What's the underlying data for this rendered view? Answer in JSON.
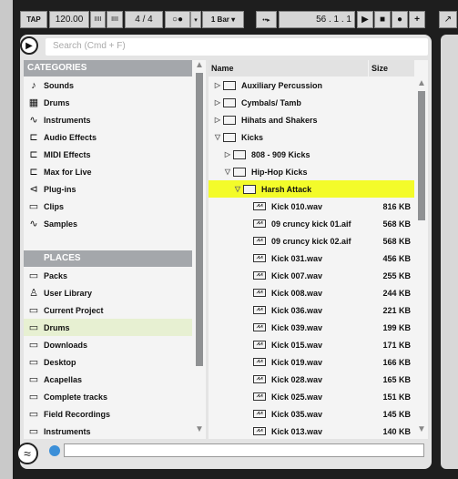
{
  "toolbar": {
    "tap": "TAP",
    "tempo": "120.00",
    "nudge_down": "IIII",
    "nudge_up": "IIII",
    "signature": "4 / 4",
    "metronome": "○●",
    "metronome_arrow": "▾",
    "quantize": "1 Bar ▾",
    "follow": "••▸",
    "position": "56 .   1 .   1",
    "play": "▶",
    "stop": "■",
    "record": "●",
    "add": "+",
    "extra": "↗"
  },
  "search": {
    "placeholder": "Search (Cmd + F)"
  },
  "categories": {
    "title": "CATEGORIES",
    "items": [
      {
        "label": "Sounds",
        "icon": "♪"
      },
      {
        "label": "Drums",
        "icon": "▦"
      },
      {
        "label": "Instruments",
        "icon": "∿"
      },
      {
        "label": "Audio Effects",
        "icon": "⊏"
      },
      {
        "label": "MIDI Effects",
        "icon": "⊏"
      },
      {
        "label": "Max for Live",
        "icon": "⊏"
      },
      {
        "label": "Plug-ins",
        "icon": "⊲"
      },
      {
        "label": "Clips",
        "icon": "▭"
      },
      {
        "label": "Samples",
        "icon": "∿"
      }
    ]
  },
  "places": {
    "title": "PLACES",
    "items": [
      {
        "label": "Packs",
        "icon": "▭"
      },
      {
        "label": "User Library",
        "icon": "♙"
      },
      {
        "label": "Current Project",
        "icon": "▭"
      },
      {
        "label": "Drums",
        "icon": "▭",
        "selected": true
      },
      {
        "label": "Downloads",
        "icon": "▭"
      },
      {
        "label": "Desktop",
        "icon": "▭"
      },
      {
        "label": "Acapellas",
        "icon": "▭"
      },
      {
        "label": "Complete tracks",
        "icon": "▭"
      },
      {
        "label": "Field Recordings",
        "icon": "▭"
      },
      {
        "label": "Instruments",
        "icon": "▭"
      }
    ]
  },
  "files": {
    "col_name": "Name",
    "col_size": "Size",
    "rows": [
      {
        "name": "Auxiliary Percussion",
        "type": "folder",
        "depth": 0,
        "open": false,
        "size": ""
      },
      {
        "name": "Cymbals/ Tamb",
        "type": "folder",
        "depth": 0,
        "open": false,
        "size": ""
      },
      {
        "name": "Hihats and Shakers",
        "type": "folder",
        "depth": 0,
        "open": false,
        "size": ""
      },
      {
        "name": "Kicks",
        "type": "folder",
        "depth": 0,
        "open": true,
        "size": ""
      },
      {
        "name": "808 - 909 Kicks",
        "type": "folder",
        "depth": 1,
        "open": false,
        "size": ""
      },
      {
        "name": "Hip-Hop Kicks",
        "type": "folder",
        "depth": 1,
        "open": true,
        "size": ""
      },
      {
        "name": "Harsh Attack",
        "type": "folder",
        "depth": 2,
        "open": true,
        "size": "",
        "highlight": true
      },
      {
        "name": "Kick 010.wav",
        "type": "file",
        "depth": 3,
        "size": "816 KB"
      },
      {
        "name": "09 cruncy kick 01.aif",
        "type": "file",
        "depth": 3,
        "size": "568 KB"
      },
      {
        "name": "09 cruncy kick 02.aif",
        "type": "file",
        "depth": 3,
        "size": "568 KB"
      },
      {
        "name": "Kick 031.wav",
        "type": "file",
        "depth": 3,
        "size": "456 KB"
      },
      {
        "name": "Kick 007.wav",
        "type": "file",
        "depth": 3,
        "size": "255 KB"
      },
      {
        "name": "Kick 008.wav",
        "type": "file",
        "depth": 3,
        "size": "244 KB"
      },
      {
        "name": "Kick 036.wav",
        "type": "file",
        "depth": 3,
        "size": "221 KB"
      },
      {
        "name": "Kick 039.wav",
        "type": "file",
        "depth": 3,
        "size": "199 KB"
      },
      {
        "name": "Kick 015.wav",
        "type": "file",
        "depth": 3,
        "size": "171 KB"
      },
      {
        "name": "Kick 019.wav",
        "type": "file",
        "depth": 3,
        "size": "166 KB"
      },
      {
        "name": "Kick 028.wav",
        "type": "file",
        "depth": 3,
        "size": "165 KB"
      },
      {
        "name": "Kick 025.wav",
        "type": "file",
        "depth": 3,
        "size": "151 KB"
      },
      {
        "name": "Kick 035.wav",
        "type": "file",
        "depth": 3,
        "size": "145 KB"
      },
      {
        "name": "Kick 013.wav",
        "type": "file",
        "depth": 3,
        "size": "140 KB"
      }
    ]
  },
  "colors": {
    "highlight": "#f3fb2a",
    "selected": "#e7f0d2",
    "header": "#a4a7ab"
  }
}
